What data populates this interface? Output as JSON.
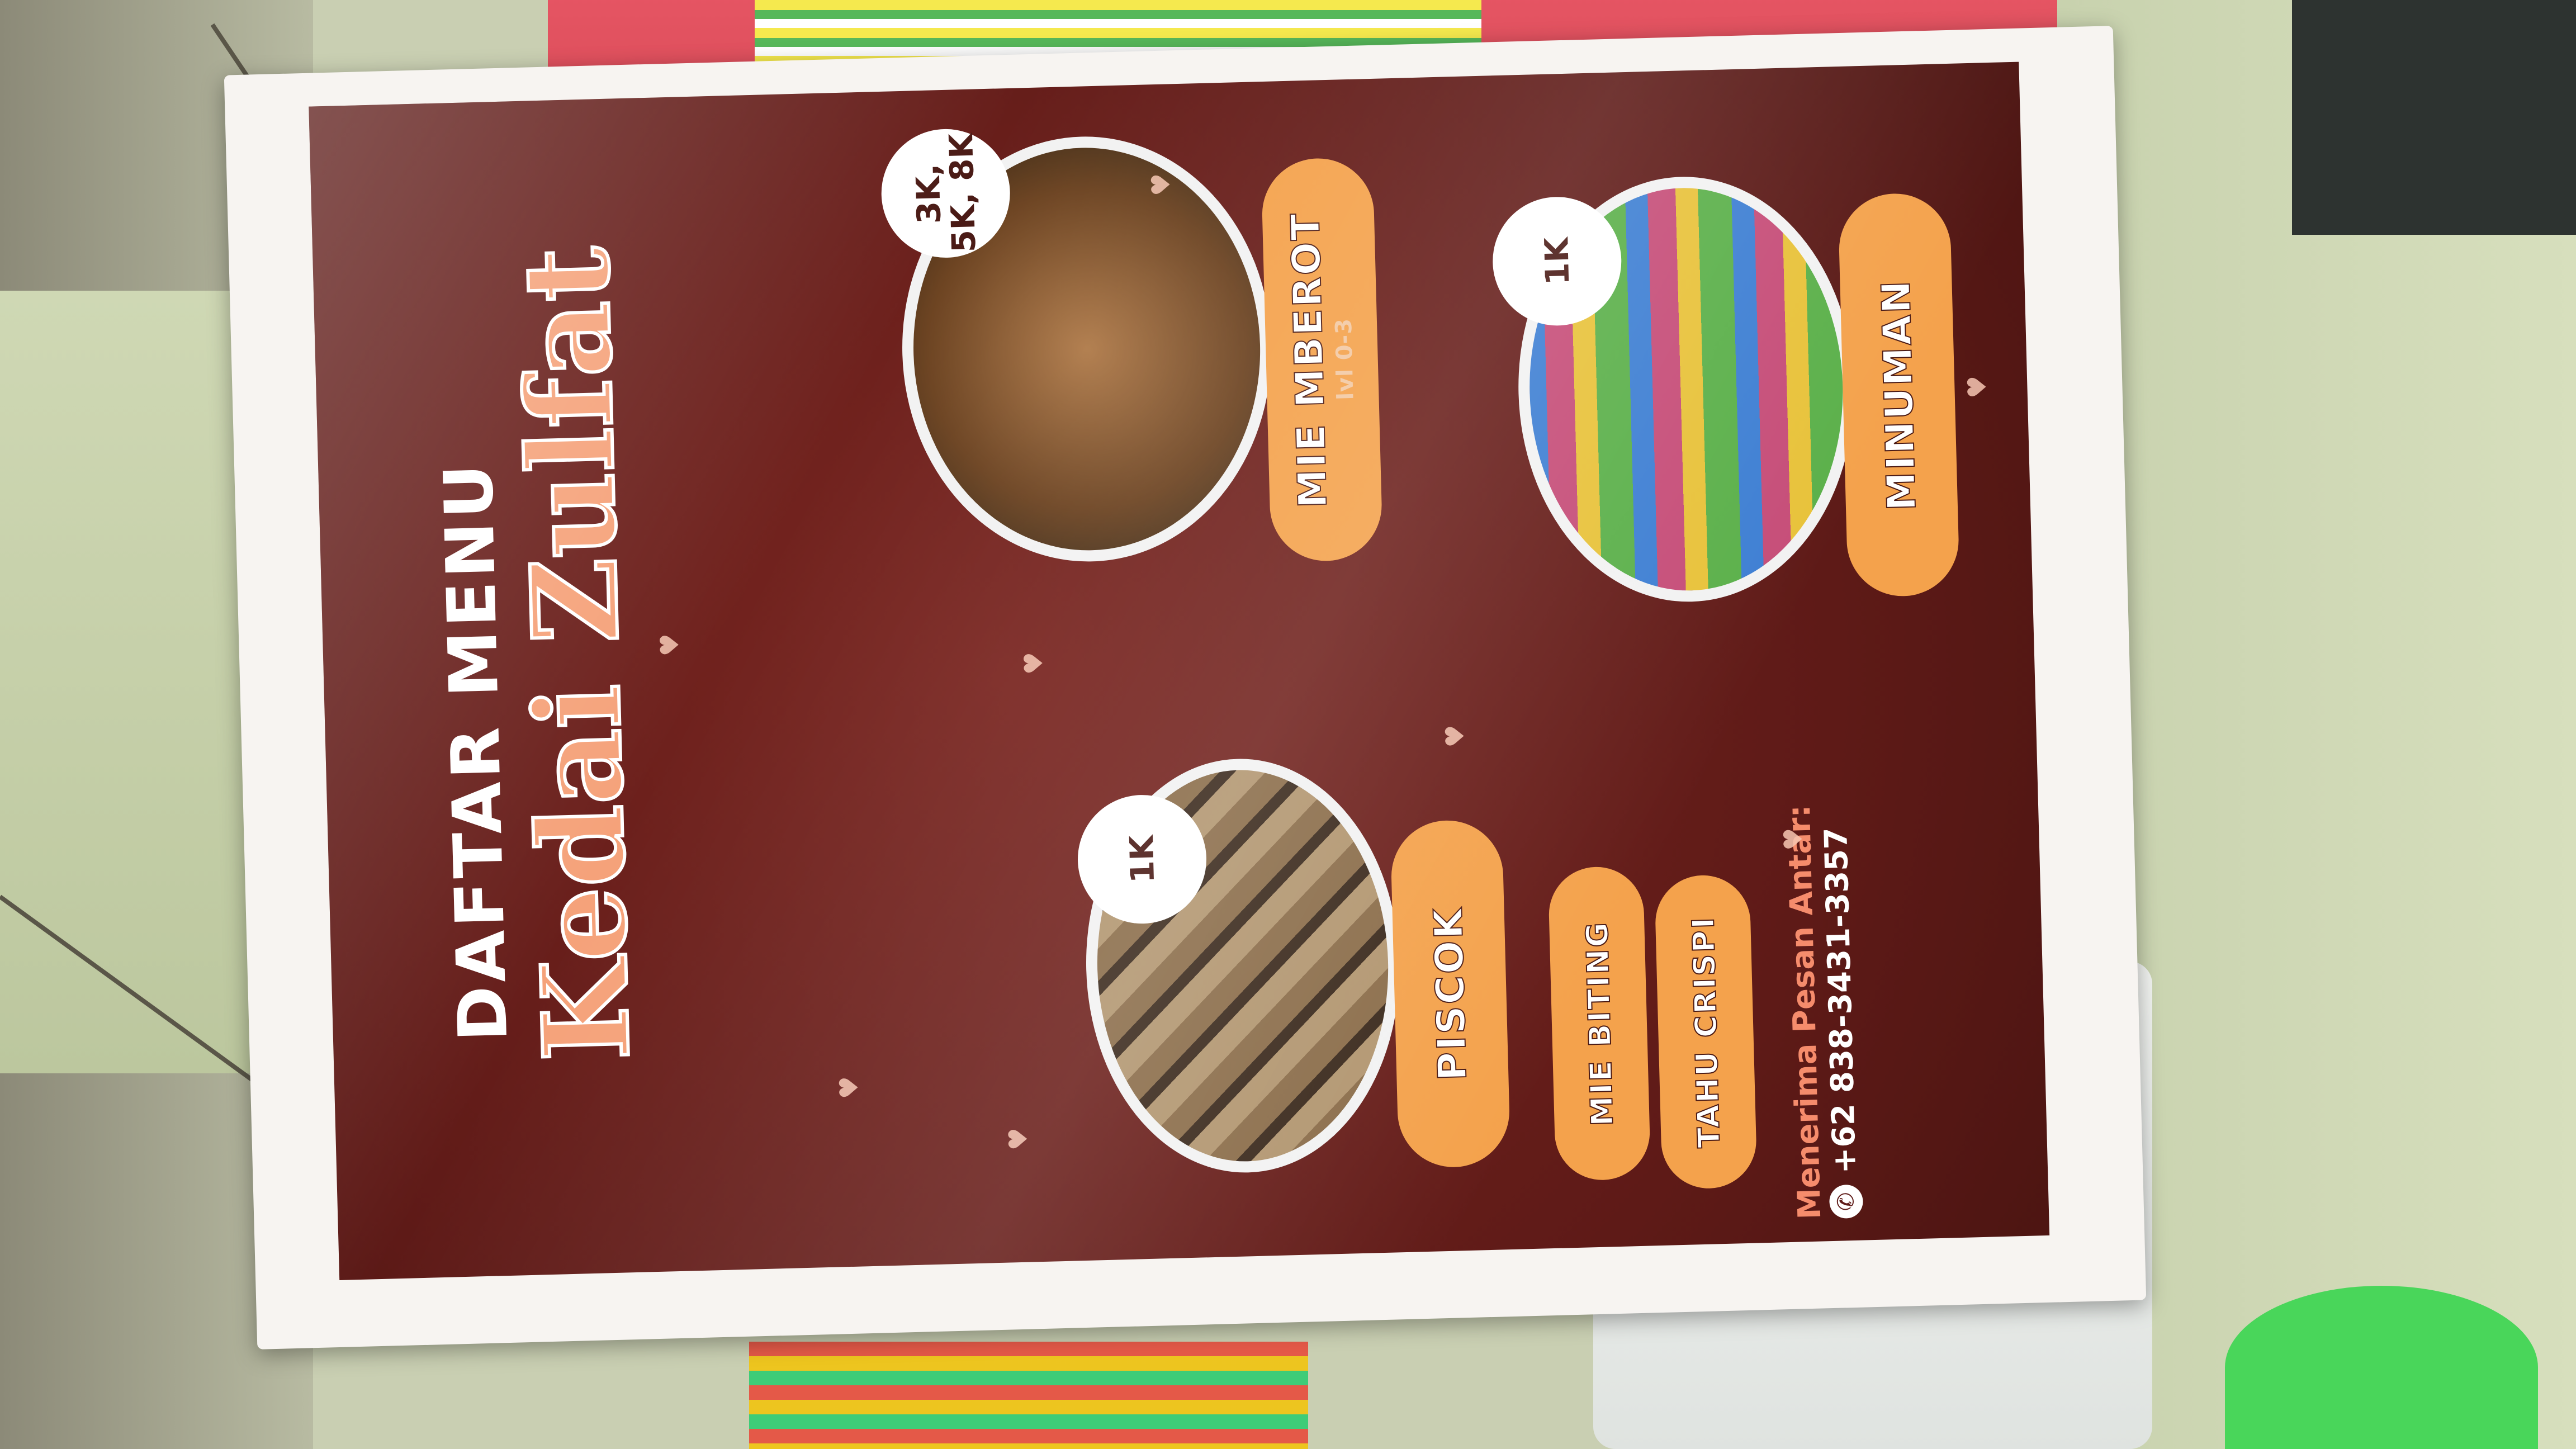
{
  "poster": {
    "title_small": "DAFTAR MENU",
    "title_big": "Kedai Zulfat",
    "items": [
      {
        "name": "MIE MBEROT",
        "sub": "lvl 0-3",
        "price": "3K, 5K, 8K"
      },
      {
        "name": "PISCOK",
        "price": "1K"
      },
      {
        "name": "MIE BITING"
      },
      {
        "name": "TAHU CRISPI"
      },
      {
        "name": "MINUMAN",
        "price": "1K"
      }
    ],
    "order_text": "Menerima Pesan Antar:",
    "phone": "+62 838-3431-3357"
  }
}
